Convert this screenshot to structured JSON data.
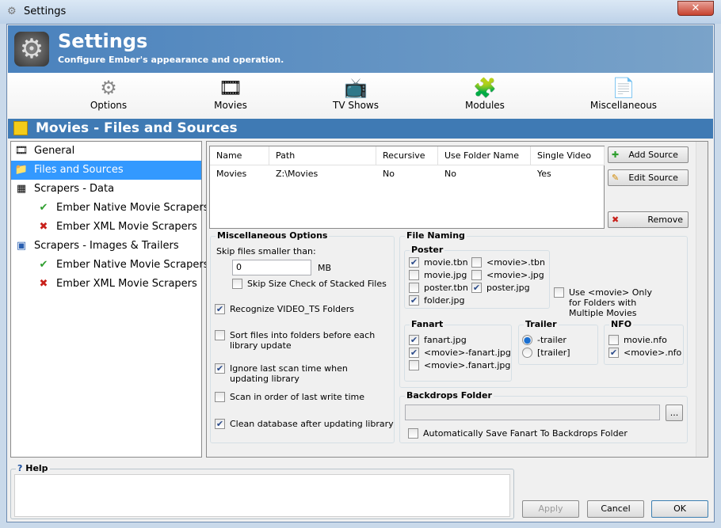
{
  "window": {
    "title": "Settings",
    "close": "✕"
  },
  "header": {
    "title": "Settings",
    "subtitle": "Configure Ember's appearance and operation."
  },
  "toolbar": [
    {
      "label": "Options",
      "icon": "⚙"
    },
    {
      "label": "Movies",
      "icon": "🎞"
    },
    {
      "label": "TV Shows",
      "icon": "📺"
    },
    {
      "label": "Modules",
      "icon": "🧩"
    },
    {
      "label": "Miscellaneous",
      "icon": "📄"
    }
  ],
  "section_title": "Movies - Files and Sources",
  "tree": [
    {
      "label": "General",
      "icon": "🎞"
    },
    {
      "label": "Files and Sources",
      "icon": "📁"
    },
    {
      "label": "Scrapers - Data",
      "icon": "▦"
    },
    {
      "label": "Ember Native Movie Scrapers",
      "icon": "✔"
    },
    {
      "label": "Ember XML Movie Scrapers",
      "icon": "✖"
    },
    {
      "label": "Scrapers - Images & Trailers",
      "icon": "▣"
    },
    {
      "label": "Ember Native Movie Scrapers",
      "icon": "✔"
    },
    {
      "label": "Ember XML Movie Scrapers",
      "icon": "✖"
    }
  ],
  "sources": {
    "columns": [
      "Name",
      "Path",
      "Recursive",
      "Use Folder Name",
      "Single Video"
    ],
    "rows": [
      [
        "Movies",
        "Z:\\Movies",
        "No",
        "No",
        "Yes"
      ]
    ]
  },
  "source_buttons": {
    "add": "Add Source",
    "edit": "Edit Source",
    "remove": "Remove"
  },
  "misc": {
    "title": "Miscellaneous Options",
    "skip_label": "Skip files smaller than:",
    "skip_value": "0",
    "skip_unit": "MB",
    "skip_stacked": "Skip Size Check of Stacked Files",
    "video_ts": "Recognize VIDEO_TS Folders",
    "sort_files": "Sort files into folders before each library update",
    "ignore_scan": "Ignore last scan time when updating library",
    "scan_order": "Scan in order of last write time",
    "clean_db": "Clean database after updating library"
  },
  "naming": {
    "title": "File Naming",
    "poster_title": "Poster",
    "poster": [
      {
        "label": "movie.tbn",
        "checked": true
      },
      {
        "label": "movie.jpg",
        "checked": false
      },
      {
        "label": "poster.tbn",
        "checked": false
      },
      {
        "label": "folder.jpg",
        "checked": true
      },
      {
        "label": "<movie>.tbn",
        "checked": false
      },
      {
        "label": "<movie>.jpg",
        "checked": false
      },
      {
        "label": "poster.jpg",
        "checked": true
      }
    ],
    "use_movie_only": "Use <movie> Only for Folders with Multiple Movies",
    "fanart_title": "Fanart",
    "fanart": [
      {
        "label": "fanart.jpg",
        "checked": true
      },
      {
        "label": "<movie>-fanart.jpg",
        "checked": true
      },
      {
        "label": "<movie>.fanart.jpg",
        "checked": false
      }
    ],
    "trailer_title": "Trailer",
    "trailer": [
      {
        "label": "-trailer",
        "selected": true
      },
      {
        "label": "[trailer]",
        "selected": false
      }
    ],
    "nfo_title": "NFO",
    "nfo": [
      {
        "label": "movie.nfo",
        "checked": false
      },
      {
        "label": "<movie>.nfo",
        "checked": true
      }
    ]
  },
  "backdrops": {
    "title": "Backdrops Folder",
    "value": "",
    "browse": "...",
    "auto_save": "Automatically Save Fanart To Backdrops Folder"
  },
  "help": {
    "title": "Help",
    "icon": "?"
  },
  "buttons": {
    "apply": "Apply",
    "cancel": "Cancel",
    "ok": "OK"
  }
}
